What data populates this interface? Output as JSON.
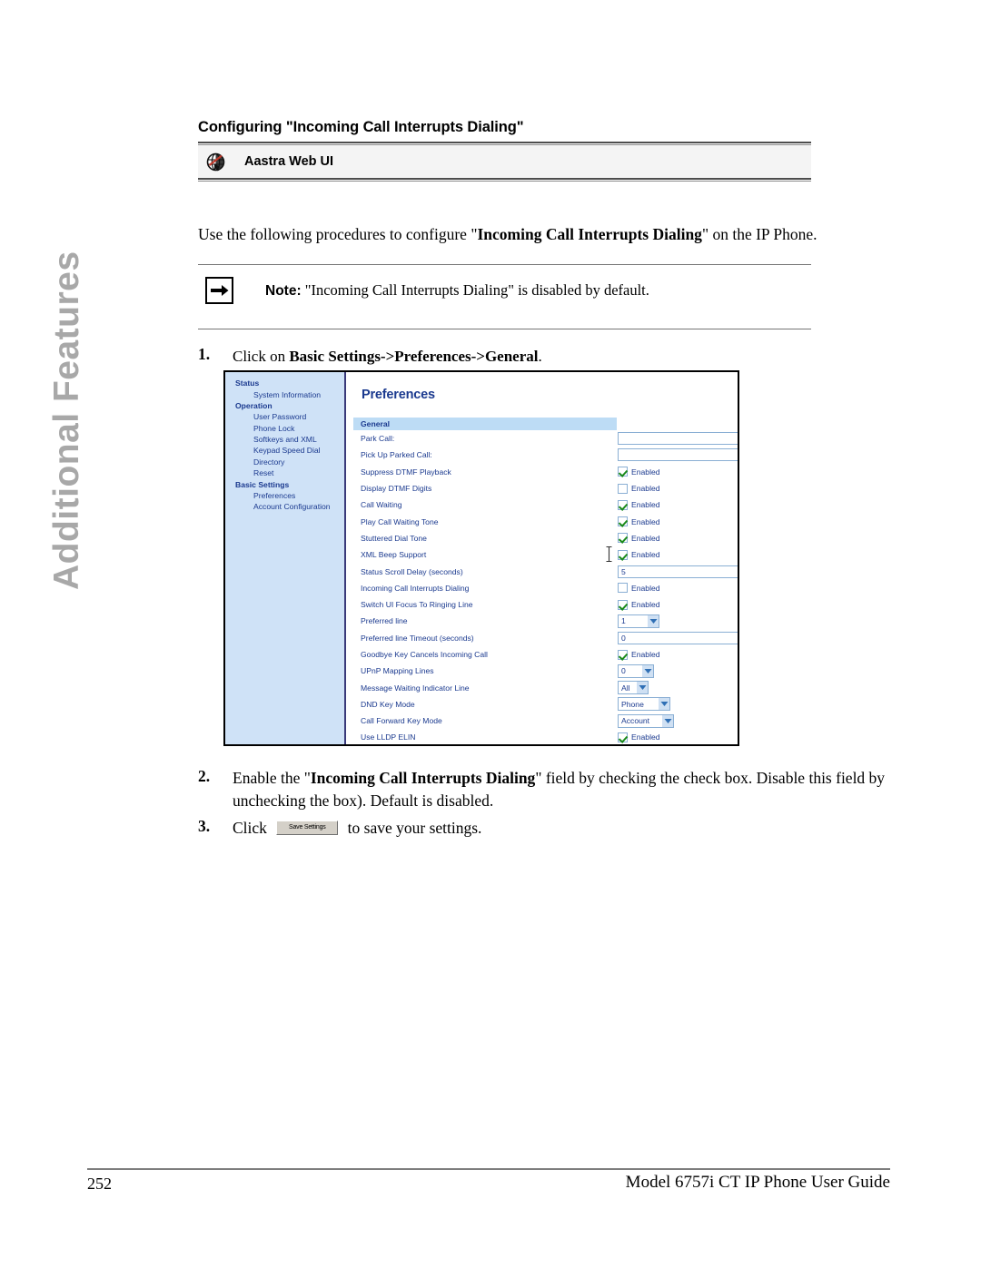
{
  "side_tab": {
    "label": "Additional Features"
  },
  "page_heading": "Configuring \"Incoming Call Interrupts Dialing\"",
  "webui_banner": {
    "icon": "aastra-globe-icon",
    "label": "Aastra Web UI"
  },
  "intro": {
    "before": "Use the following procedures to configure \"",
    "bold": "Incoming Call Interrupts Dialing",
    "after": "\" on the IP Phone."
  },
  "note": {
    "icon": "right-arrow-icon",
    "label": "Note:",
    "text": "\"Incoming Call Interrupts Dialing\" is disabled by default."
  },
  "steps": {
    "one": {
      "num": "1.",
      "before": "Click on ",
      "bold": "Basic Settings->Preferences->General",
      "after": "."
    },
    "two": {
      "num": "2.",
      "before": "Enable the \"",
      "bold": "Incoming Call Interrupts Dialing",
      "after": "\" field by checking the check box. Disable this field by unchecking the box). Default is disabled."
    },
    "three": {
      "num": "3.",
      "before": "Click ",
      "button": "Save Settings",
      "after": " to save your settings."
    }
  },
  "webui_shot": {
    "title": "Preferences",
    "nav": [
      {
        "type": "group",
        "label": "Status"
      },
      {
        "type": "item",
        "label": "System Information"
      },
      {
        "type": "group",
        "label": "Operation"
      },
      {
        "type": "item",
        "label": "User Password"
      },
      {
        "type": "item",
        "label": "Phone Lock"
      },
      {
        "type": "item",
        "label": "Softkeys and XML"
      },
      {
        "type": "item",
        "label": "Keypad Speed Dial"
      },
      {
        "type": "item",
        "label": "Directory"
      },
      {
        "type": "item",
        "label": "Reset"
      },
      {
        "type": "group",
        "label": "Basic Settings"
      },
      {
        "type": "item",
        "label": "Preferences"
      },
      {
        "type": "item",
        "label": "Account Configuration"
      }
    ],
    "section_header": "General",
    "enabled_label": "Enabled",
    "fields": [
      {
        "label": "Park Call:",
        "control": "text",
        "value": ""
      },
      {
        "label": "Pick Up Parked Call:",
        "control": "text",
        "value": ""
      },
      {
        "label": "Suppress DTMF Playback",
        "control": "checkbox",
        "checked": true
      },
      {
        "label": "Display DTMF Digits",
        "control": "checkbox",
        "checked": false
      },
      {
        "label": "Call Waiting",
        "control": "checkbox",
        "checked": true
      },
      {
        "label": "Play Call Waiting Tone",
        "control": "checkbox",
        "checked": true
      },
      {
        "label": "Stuttered Dial Tone",
        "control": "checkbox",
        "checked": true
      },
      {
        "label": "XML Beep Support",
        "control": "checkbox",
        "checked": true
      },
      {
        "label": "Status Scroll Delay (seconds)",
        "control": "text",
        "value": "5"
      },
      {
        "label": "Incoming Call Interrupts Dialing",
        "control": "checkbox",
        "checked": false
      },
      {
        "label": "Switch UI Focus To Ringing Line",
        "control": "checkbox",
        "checked": true
      },
      {
        "label": "Preferred line",
        "control": "select",
        "value": "1",
        "width": "w1"
      },
      {
        "label": "Preferred line Timeout (seconds)",
        "control": "text",
        "value": "0"
      },
      {
        "label": "Goodbye Key Cancels Incoming Call",
        "control": "checkbox",
        "checked": true
      },
      {
        "label": "UPnP Mapping Lines",
        "control": "select",
        "value": "0",
        "width": "w2"
      },
      {
        "label": "Message Waiting Indicator Line",
        "control": "select",
        "value": "All",
        "width": "w3"
      },
      {
        "label": "DND Key Mode",
        "control": "select",
        "value": "Phone",
        "width": "w4"
      },
      {
        "label": "Call Forward Key Mode",
        "control": "select",
        "value": "Account",
        "width": "w5"
      },
      {
        "label": "Use LLDP ELIN",
        "control": "checkbox",
        "checked": true
      }
    ]
  },
  "footer": {
    "page_number": "252",
    "title": "Model 6757i CT IP Phone User Guide"
  },
  "colors": {
    "nav_blue": "#1b3a8f",
    "sidebar_bg": "#cfe2f7",
    "section_header_bg": "#bddcf5",
    "check_green": "#1a8a1a",
    "side_tab_gray": "#a8a8a8"
  }
}
